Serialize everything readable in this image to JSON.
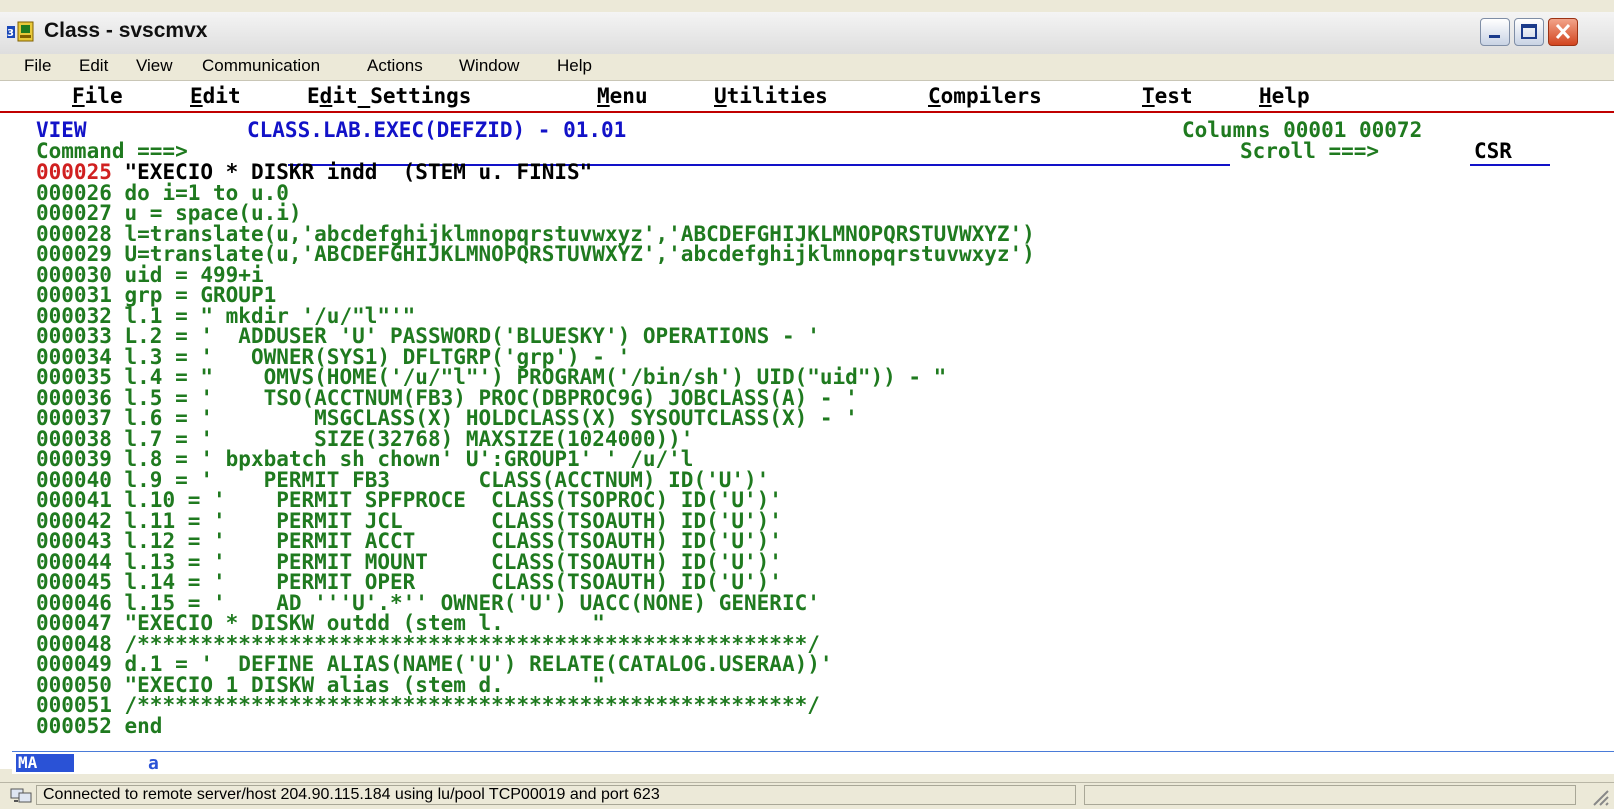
{
  "window": {
    "title": "Class - svscmvx"
  },
  "menubar": [
    "File",
    "Edit",
    "View",
    "Communication",
    "Actions",
    "Window",
    "Help"
  ],
  "ispf_menu": [
    {
      "pre": "",
      "ul": "F",
      "post": "ile"
    },
    {
      "pre": "",
      "ul": "E",
      "post": "dit"
    },
    {
      "pre": "E",
      "ul": "d",
      "post": "it_Settings"
    },
    {
      "pre": "",
      "ul": "M",
      "post": "enu"
    },
    {
      "pre": "",
      "ul": "U",
      "post": "tilities"
    },
    {
      "pre": "",
      "ul": "C",
      "post": "ompilers"
    },
    {
      "pre": "",
      "ul": "T",
      "post": "est"
    },
    {
      "pre": "",
      "ul": "H",
      "post": "elp"
    }
  ],
  "header": {
    "mode": "VIEW",
    "dataset": "CLASS.LAB.EXEC(DEFZID) - 01.01",
    "columns": "Columns 00001 00072",
    "command_label": "Command ===>",
    "command_value": "",
    "scroll_label": "Scroll ===>",
    "scroll_value": "CSR"
  },
  "lines": [
    {
      "num": "000025",
      "text": "\"EXECIO * DISKR indd  (STEM u. FINIS\""
    },
    {
      "num": "000026",
      "text": "do i=1 to u.0"
    },
    {
      "num": "000027",
      "text": "u = space(u.i)"
    },
    {
      "num": "000028",
      "text": "l=translate(u,'abcdefghijklmnopqrstuvwxyz','ABCDEFGHIJKLMNOPQRSTUVWXYZ')"
    },
    {
      "num": "000029",
      "text": "U=translate(u,'ABCDEFGHIJKLMNOPQRSTUVWXYZ','abcdefghijklmnopqrstuvwxyz')"
    },
    {
      "num": "000030",
      "text": "uid = 499+i"
    },
    {
      "num": "000031",
      "text": "grp = GROUP1"
    },
    {
      "num": "000032",
      "text": "l.1 = \" mkdir '/u/\"l\"'\""
    },
    {
      "num": "000033",
      "text": "L.2 = '  ADDUSER 'U' PASSWORD('BLUESKY') OPERATIONS - '"
    },
    {
      "num": "000034",
      "text": "l.3 = '   OWNER(SYS1) DFLTGRP('grp') - '"
    },
    {
      "num": "000035",
      "text": "l.4 = \"    OMVS(HOME('/u/\"l\"') PROGRAM('/bin/sh') UID(\"uid\")) - \""
    },
    {
      "num": "000036",
      "text": "l.5 = '    TSO(ACCTNUM(FB3) PROC(DBPROC9G) JOBCLASS(A) - '"
    },
    {
      "num": "000037",
      "text": "l.6 = '        MSGCLASS(X) HOLDCLASS(X) SYSOUTCLASS(X) - '"
    },
    {
      "num": "000038",
      "text": "l.7 = '        SIZE(32768) MAXSIZE(1024000))'"
    },
    {
      "num": "000039",
      "text": "l.8 = ' bpxbatch sh chown' U':GROUP1' ' /u/'l"
    },
    {
      "num": "000040",
      "text": "l.9 = '    PERMIT FB3       CLASS(ACCTNUM) ID('U')'"
    },
    {
      "num": "000041",
      "text": "l.10 = '    PERMIT SPFPROCE  CLASS(TSOPROC) ID('U')'"
    },
    {
      "num": "000042",
      "text": "l.11 = '    PERMIT JCL       CLASS(TSOAUTH) ID('U')'"
    },
    {
      "num": "000043",
      "text": "l.12 = '    PERMIT ACCT      CLASS(TSOAUTH) ID('U')'"
    },
    {
      "num": "000044",
      "text": "l.13 = '    PERMIT MOUNT     CLASS(TSOAUTH) ID('U')'"
    },
    {
      "num": "000045",
      "text": "l.14 = '    PERMIT OPER      CLASS(TSOAUTH) ID('U')'"
    },
    {
      "num": "000046",
      "text": "l.15 = '    AD '''U'.*'' OWNER('U') UACC(NONE) GENERIC'"
    },
    {
      "num": "000047",
      "text": "\"EXECIO * DISKW outdd (stem l.       \""
    },
    {
      "num": "000048",
      "text": "/*****************************************************/"
    },
    {
      "num": "000049",
      "text": "d.1 = '  DEFINE ALIAS(NAME('U') RELATE(CATALOG.USERAA))'"
    },
    {
      "num": "000050",
      "text": "\"EXECIO 1 DISKW alias (stem d.       \""
    },
    {
      "num": "000051",
      "text": "/*****************************************************/"
    },
    {
      "num": "000052",
      "text": "end"
    }
  ],
  "oia": {
    "mode": "MA",
    "indicator": "a"
  },
  "status": {
    "text": "Connected to remote server/host 204.90.115.184 using lu/pool TCP00019 and port 623"
  },
  "colors": {
    "text_green": "#1f7a1f",
    "text_blue": "#1212c8",
    "line_number_current": "#d02020",
    "text_black": "#000000"
  }
}
